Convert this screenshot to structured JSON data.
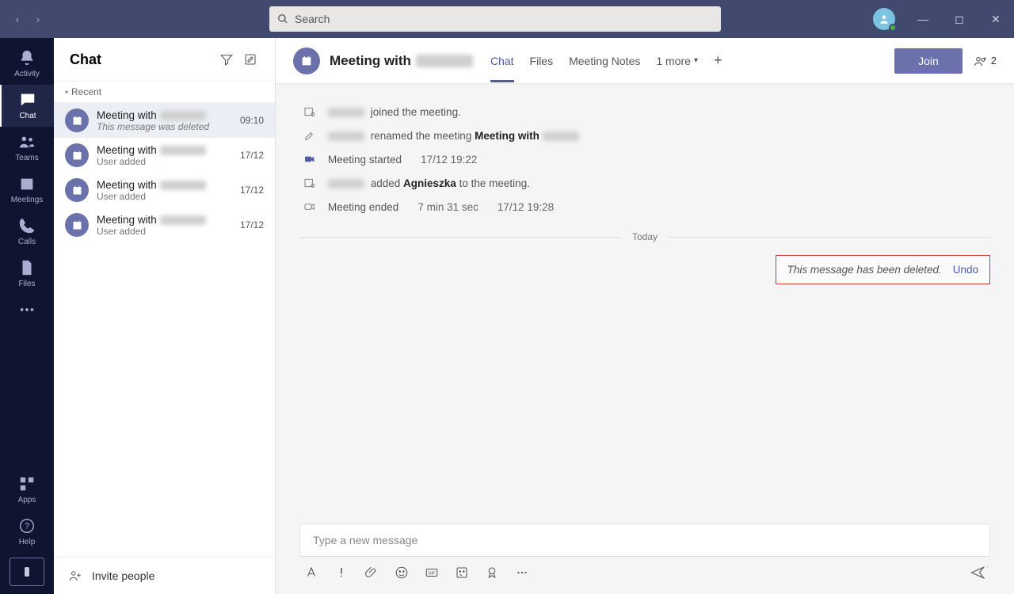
{
  "titlebar": {
    "search_placeholder": "Search"
  },
  "rail": {
    "items": [
      {
        "label": "Activity"
      },
      {
        "label": "Chat"
      },
      {
        "label": "Teams"
      },
      {
        "label": "Meetings"
      },
      {
        "label": "Calls"
      },
      {
        "label": "Files"
      }
    ],
    "apps_label": "Apps",
    "help_label": "Help"
  },
  "chatlist": {
    "heading": "Chat",
    "section": "Recent",
    "rows": [
      {
        "title": "Meeting with ",
        "sub": "This message was deleted",
        "time": "09:10",
        "sub_italic": true
      },
      {
        "title": "Meeting with ",
        "sub": "User added",
        "time": "17/12",
        "sub_italic": false
      },
      {
        "title": "Meeting with ",
        "sub": "User added",
        "time": "17/12",
        "sub_italic": false
      },
      {
        "title": "Meeting with ",
        "sub": "User added",
        "time": "17/12",
        "sub_italic": false
      }
    ],
    "invite": "Invite people"
  },
  "conv": {
    "title": "Meeting with ",
    "tabs": {
      "chat": "Chat",
      "files": "Files",
      "notes": "Meeting Notes",
      "more": "1 more"
    },
    "join": "Join",
    "people": "2"
  },
  "sys": {
    "joined": " joined the meeting.",
    "renamed_pre": " renamed the meeting ",
    "renamed_bold": "Meeting with ",
    "started": "Meeting started",
    "started_ts": "17/12 19:22",
    "added_pre": " added ",
    "added_name": "Agnieszka",
    "added_post": " to the meeting.",
    "ended": "Meeting ended",
    "ended_dur": "7 min 31 sec",
    "ended_ts": "17/12 19:28",
    "today": "Today"
  },
  "deleted": {
    "text": "This message has been deleted.",
    "undo": "Undo"
  },
  "composer": {
    "placeholder": "Type a new message"
  }
}
